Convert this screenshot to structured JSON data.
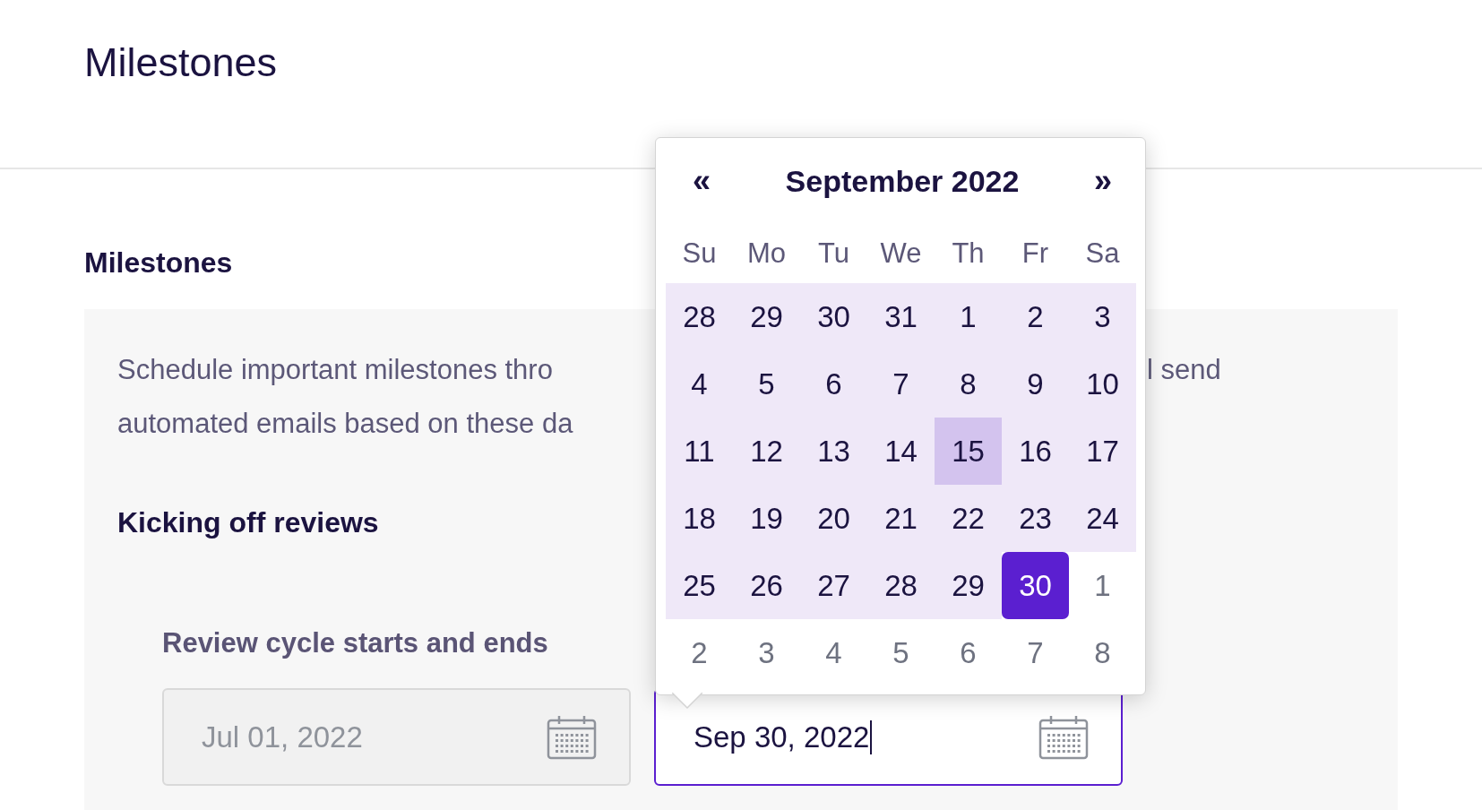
{
  "page": {
    "title": "Milestones"
  },
  "section": {
    "heading": "Milestones",
    "description": {
      "lines": [
        {
          "left": "Schedule important milestones thro",
          "right": "l send"
        },
        {
          "left": "automated emails based on these da"
        }
      ]
    },
    "subheading": "Kicking off reviews",
    "field_label": "Review cycle starts and ends",
    "fields": [
      {
        "value": "Jul 01, 2022",
        "disabled": true,
        "focused": false
      },
      {
        "value": "Sep 30, 2022",
        "disabled": false,
        "focused": true
      }
    ]
  },
  "calendar": {
    "prev": "«",
    "title": "September 2022",
    "next": "»",
    "weekdays": [
      "Su",
      "Mo",
      "Tu",
      "We",
      "Th",
      "Fr",
      "Sa"
    ],
    "weeks": [
      [
        {
          "label": "28",
          "outside": false,
          "in_range": true,
          "highlighted": false,
          "selected": false
        },
        {
          "label": "29",
          "outside": false,
          "in_range": true,
          "highlighted": false,
          "selected": false
        },
        {
          "label": "30",
          "outside": false,
          "in_range": true,
          "highlighted": false,
          "selected": false
        },
        {
          "label": "31",
          "outside": false,
          "in_range": true,
          "highlighted": false,
          "selected": false
        },
        {
          "label": "1",
          "outside": false,
          "in_range": true,
          "highlighted": false,
          "selected": false
        },
        {
          "label": "2",
          "outside": false,
          "in_range": true,
          "highlighted": false,
          "selected": false
        },
        {
          "label": "3",
          "outside": false,
          "in_range": true,
          "highlighted": false,
          "selected": false
        }
      ],
      [
        {
          "label": "4",
          "outside": false,
          "in_range": true,
          "highlighted": false,
          "selected": false
        },
        {
          "label": "5",
          "outside": false,
          "in_range": true,
          "highlighted": false,
          "selected": false
        },
        {
          "label": "6",
          "outside": false,
          "in_range": true,
          "highlighted": false,
          "selected": false
        },
        {
          "label": "7",
          "outside": false,
          "in_range": true,
          "highlighted": false,
          "selected": false
        },
        {
          "label": "8",
          "outside": false,
          "in_range": true,
          "highlighted": false,
          "selected": false
        },
        {
          "label": "9",
          "outside": false,
          "in_range": true,
          "highlighted": false,
          "selected": false
        },
        {
          "label": "10",
          "outside": false,
          "in_range": true,
          "highlighted": false,
          "selected": false
        }
      ],
      [
        {
          "label": "11",
          "outside": false,
          "in_range": true,
          "highlighted": false,
          "selected": false
        },
        {
          "label": "12",
          "outside": false,
          "in_range": true,
          "highlighted": false,
          "selected": false
        },
        {
          "label": "13",
          "outside": false,
          "in_range": true,
          "highlighted": false,
          "selected": false
        },
        {
          "label": "14",
          "outside": false,
          "in_range": true,
          "highlighted": false,
          "selected": false
        },
        {
          "label": "15",
          "outside": false,
          "in_range": true,
          "highlighted": true,
          "selected": false
        },
        {
          "label": "16",
          "outside": false,
          "in_range": true,
          "highlighted": false,
          "selected": false
        },
        {
          "label": "17",
          "outside": false,
          "in_range": true,
          "highlighted": false,
          "selected": false
        }
      ],
      [
        {
          "label": "18",
          "outside": false,
          "in_range": true,
          "highlighted": false,
          "selected": false
        },
        {
          "label": "19",
          "outside": false,
          "in_range": true,
          "highlighted": false,
          "selected": false
        },
        {
          "label": "20",
          "outside": false,
          "in_range": true,
          "highlighted": false,
          "selected": false
        },
        {
          "label": "21",
          "outside": false,
          "in_range": true,
          "highlighted": false,
          "selected": false
        },
        {
          "label": "22",
          "outside": false,
          "in_range": true,
          "highlighted": false,
          "selected": false
        },
        {
          "label": "23",
          "outside": false,
          "in_range": true,
          "highlighted": false,
          "selected": false
        },
        {
          "label": "24",
          "outside": false,
          "in_range": true,
          "highlighted": false,
          "selected": false
        }
      ],
      [
        {
          "label": "25",
          "outside": false,
          "in_range": true,
          "highlighted": false,
          "selected": false
        },
        {
          "label": "26",
          "outside": false,
          "in_range": true,
          "highlighted": false,
          "selected": false
        },
        {
          "label": "27",
          "outside": false,
          "in_range": true,
          "highlighted": false,
          "selected": false
        },
        {
          "label": "28",
          "outside": false,
          "in_range": true,
          "highlighted": false,
          "selected": false
        },
        {
          "label": "29",
          "outside": false,
          "in_range": true,
          "highlighted": false,
          "selected": false
        },
        {
          "label": "30",
          "outside": false,
          "in_range": false,
          "highlighted": false,
          "selected": true
        },
        {
          "label": "1",
          "outside": true,
          "in_range": false,
          "highlighted": false,
          "selected": false
        }
      ],
      [
        {
          "label": "2",
          "outside": true,
          "in_range": false,
          "highlighted": false,
          "selected": false
        },
        {
          "label": "3",
          "outside": true,
          "in_range": false,
          "highlighted": false,
          "selected": false
        },
        {
          "label": "4",
          "outside": true,
          "in_range": false,
          "highlighted": false,
          "selected": false
        },
        {
          "label": "5",
          "outside": true,
          "in_range": false,
          "highlighted": false,
          "selected": false
        },
        {
          "label": "6",
          "outside": true,
          "in_range": false,
          "highlighted": false,
          "selected": false
        },
        {
          "label": "7",
          "outside": true,
          "in_range": false,
          "highlighted": false,
          "selected": false
        },
        {
          "label": "8",
          "outside": true,
          "in_range": false,
          "highlighted": false,
          "selected": false
        }
      ]
    ]
  }
}
